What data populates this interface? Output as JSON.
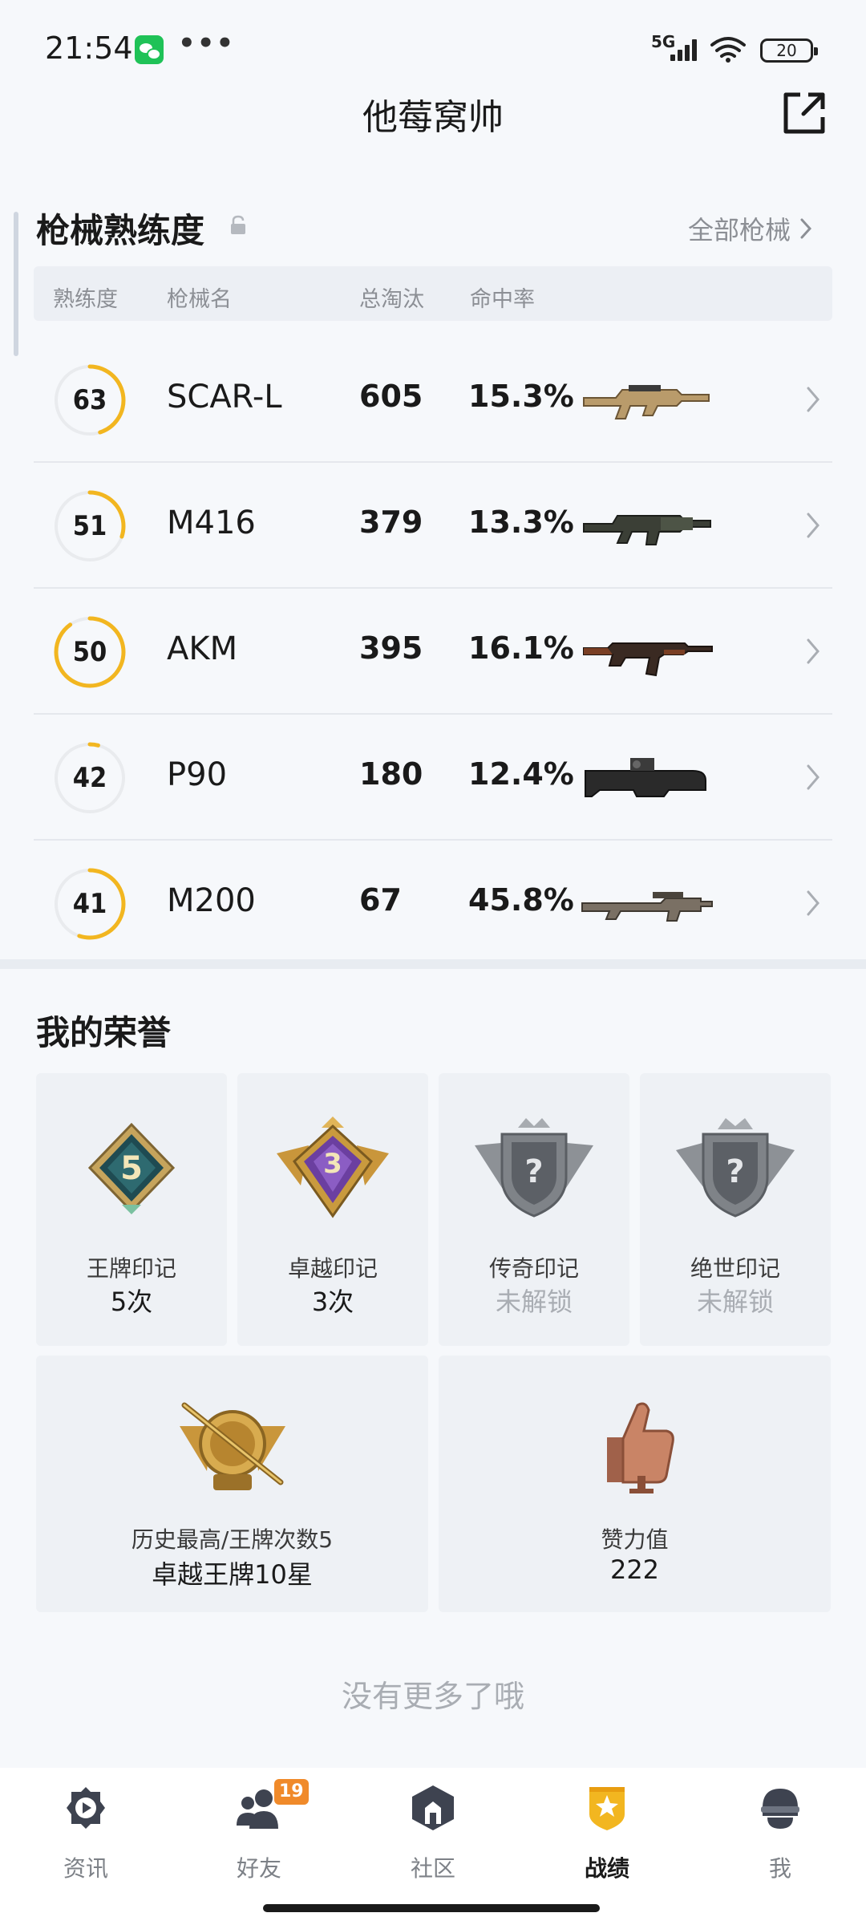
{
  "status_bar": {
    "time": "21:54",
    "dots": "•••",
    "network": "5G",
    "battery": "20",
    "icons": [
      "wechat-icon",
      "signal-icon",
      "wifi-icon",
      "battery-icon"
    ]
  },
  "header": {
    "title": "他莓窝帅",
    "share_icon": "share-external-icon"
  },
  "weapon_section": {
    "title": "枪械熟练度",
    "lock_icon": "lock-icon",
    "all_link": "全部枪械",
    "columns": [
      "熟练度",
      "枪械名",
      "总淘汰",
      "命中率"
    ],
    "rows": [
      {
        "level": "63",
        "name": "SCAR-L",
        "kills": "605",
        "rate": "15.3%",
        "progress": 0.45,
        "weapon": "scar-l"
      },
      {
        "level": "51",
        "name": "M416",
        "kills": "379",
        "rate": "13.3%",
        "progress": 0.3,
        "weapon": "m416"
      },
      {
        "level": "50",
        "name": "AKM",
        "kills": "395",
        "rate": "16.1%",
        "progress": 0.9,
        "weapon": "akm"
      },
      {
        "level": "42",
        "name": "P90",
        "kills": "180",
        "rate": "12.4%",
        "progress": 0.04,
        "weapon": "p90"
      },
      {
        "level": "41",
        "name": "M200",
        "kills": "67",
        "rate": "45.8%",
        "progress": 0.55,
        "weapon": "m200"
      }
    ]
  },
  "honors": {
    "title": "我的荣誉",
    "marks": [
      {
        "label": "王牌印记",
        "value": "5次",
        "locked": false,
        "badge": "ace-badge-5"
      },
      {
        "label": "卓越印记",
        "value": "3次",
        "locked": false,
        "badge": "excellent-badge-3"
      },
      {
        "label": "传奇印记",
        "value": "未解锁",
        "locked": true,
        "badge": "legend-badge-locked"
      },
      {
        "label": "绝世印记",
        "value": "未解锁",
        "locked": true,
        "badge": "peerless-badge-locked"
      }
    ],
    "highest": {
      "label": "历史最高/王牌次数5",
      "value": "卓越王牌10星"
    },
    "likes": {
      "label": "赞力值",
      "value": "222"
    }
  },
  "footer_text": "没有更多了哦",
  "bottom_nav": [
    {
      "label": "资讯",
      "icon": "news-icon",
      "active": false
    },
    {
      "label": "好友",
      "icon": "friends-icon",
      "active": false,
      "badge": "19"
    },
    {
      "label": "社区",
      "icon": "community-icon",
      "active": false
    },
    {
      "label": "战绩",
      "icon": "record-icon",
      "active": true
    },
    {
      "label": "我",
      "icon": "profile-icon",
      "active": false
    }
  ],
  "colors": {
    "accent": "#f2b620",
    "badge": "#f08a2a",
    "ring_track": "#e9ebee"
  }
}
